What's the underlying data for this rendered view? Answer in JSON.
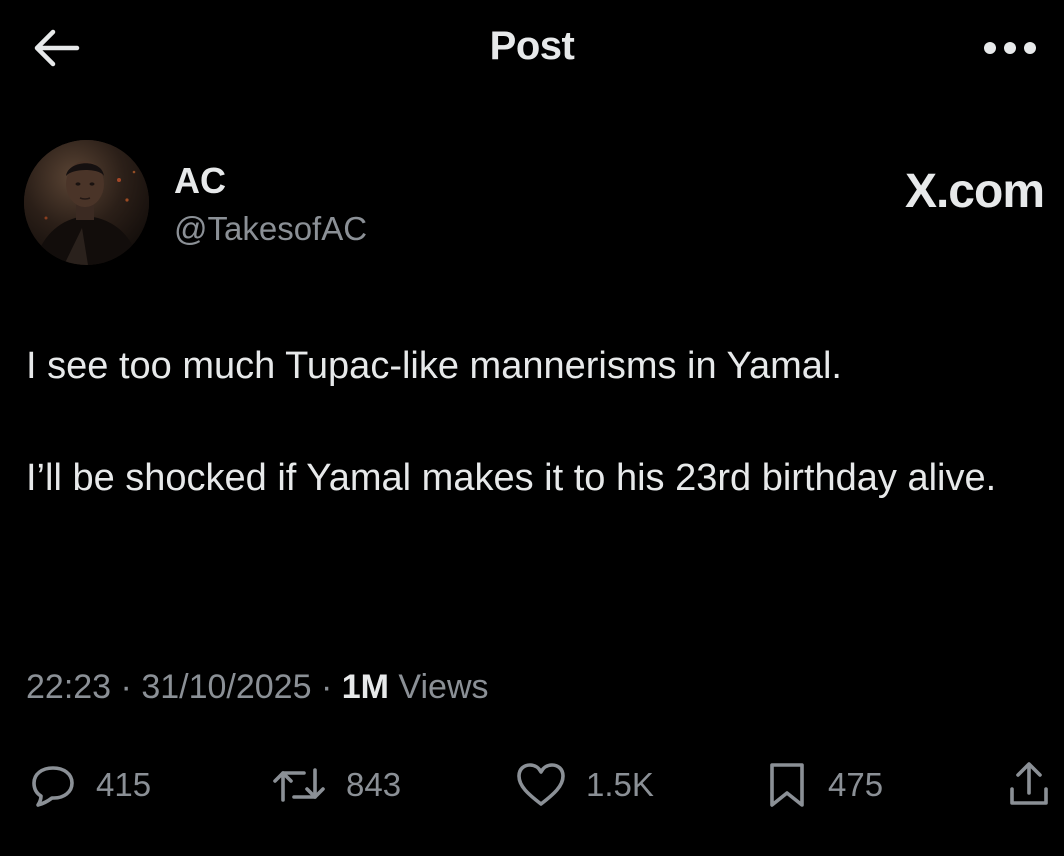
{
  "header": {
    "title": "Post",
    "back_icon": "arrow-left-icon",
    "more_icon": "more-horizontal-icon"
  },
  "author": {
    "display_name": "AC",
    "handle": "@TakesofAC"
  },
  "watermark": "X.com",
  "post": {
    "paragraphs": [
      "I see too much Tupac-like mannerisms in Yamal.",
      "I’ll be shocked if Yamal makes it to his 23rd birthday alive."
    ],
    "time": "22:23",
    "separator": "·",
    "date": "31/10/2025",
    "views_count": "1M",
    "views_label": "Views"
  },
  "actions": {
    "replies": "415",
    "reposts": "843",
    "likes": "1.5K",
    "bookmarks": "475"
  },
  "colors": {
    "background": "#000000",
    "text": "#e7e9ea",
    "muted": "#8b9096"
  }
}
